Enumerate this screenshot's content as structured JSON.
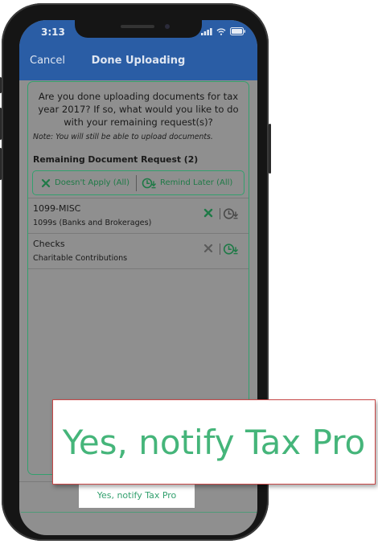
{
  "status_bar": {
    "time": "3:13"
  },
  "nav": {
    "cancel": "Cancel",
    "title": "Done Uploading"
  },
  "card": {
    "question": "Are you done uploading documents for tax year 2017? If so, what would you like to do with your remaining request(s)?",
    "note": "Note: You will still be able to upload documents.",
    "remaining_header": "Remaining Document Request (2)",
    "doesnt_apply_all": "Doesn't Apply (All)",
    "remind_later_all": "Remind Later (All)"
  },
  "requests": [
    {
      "title": "1099-MISC",
      "subtitle": "1099s (Banks and Brokerages)",
      "x_color": "#1f7a47"
    },
    {
      "title": "Checks",
      "subtitle": "Charitable Contributions",
      "x_color": "#5a5a5a"
    }
  ],
  "notify_button": {
    "label": "Yes, notify Tax Pro"
  },
  "callout": {
    "label": "Yes, notify Tax Pro"
  },
  "colors": {
    "nav_blue": "#2a5da5",
    "accent_green": "#33a06e",
    "callout_border": "#c94848"
  }
}
